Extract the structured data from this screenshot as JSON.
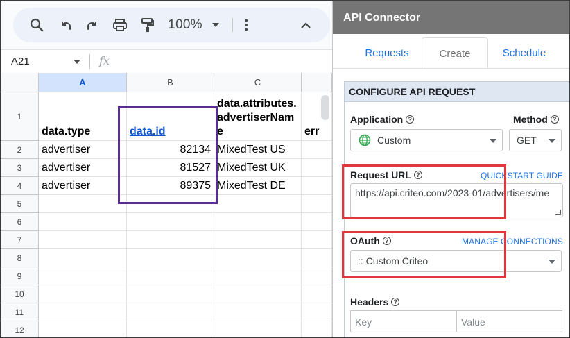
{
  "toolbar": {
    "zoom": "100%",
    "icons": [
      "search-icon",
      "undo-icon",
      "redo-icon",
      "print-icon",
      "paint-format-icon",
      "more-vert-icon",
      "chevron-up-icon"
    ]
  },
  "formula_bar": {
    "cell_ref": "A21",
    "fx": "fx",
    "value": ""
  },
  "grid": {
    "columns": [
      "A",
      "B",
      "C",
      ""
    ],
    "selected_column": "A",
    "row_numbers": [
      "1",
      "2",
      "3",
      "4",
      "5",
      "6",
      "7",
      "8",
      "9",
      "10",
      "11",
      "12"
    ],
    "rows": [
      [
        "data.type",
        "data.id",
        "data.attributes.advertiserName",
        "err"
      ],
      [
        "advertiser",
        "82134",
        "MixedTest US",
        ""
      ],
      [
        "advertiser",
        "81527",
        "MixedTest UK",
        ""
      ],
      [
        "advertiser",
        "89375",
        "MixedTest DE",
        ""
      ]
    ]
  },
  "panel": {
    "title": "API Connector",
    "tabs": [
      "Requests",
      "Create",
      "Schedule"
    ],
    "active_tab": "Create",
    "section_title": "CONFIGURE API REQUEST",
    "application": {
      "label": "Application",
      "value": "Custom"
    },
    "method": {
      "label": "Method",
      "value": "GET"
    },
    "request_url": {
      "label": "Request URL",
      "link": "QUICKSTART GUIDE",
      "value": "https://api.criteo.com/2023-01/advertisers/me"
    },
    "oauth": {
      "label": "OAuth",
      "link": "MANAGE CONNECTIONS",
      "value": ":: Custom Criteo"
    },
    "headers": {
      "label": "Headers",
      "key_placeholder": "Key",
      "value_placeholder": "Value"
    }
  },
  "colors": {
    "panel_title_bg": "#757575",
    "section_bg": "#dfe7f3",
    "link_blue": "#1a73e8",
    "highlight_red": "#e0383e",
    "highlight_purple": "#5b2d91",
    "selected_column": "#d3e3fd"
  }
}
